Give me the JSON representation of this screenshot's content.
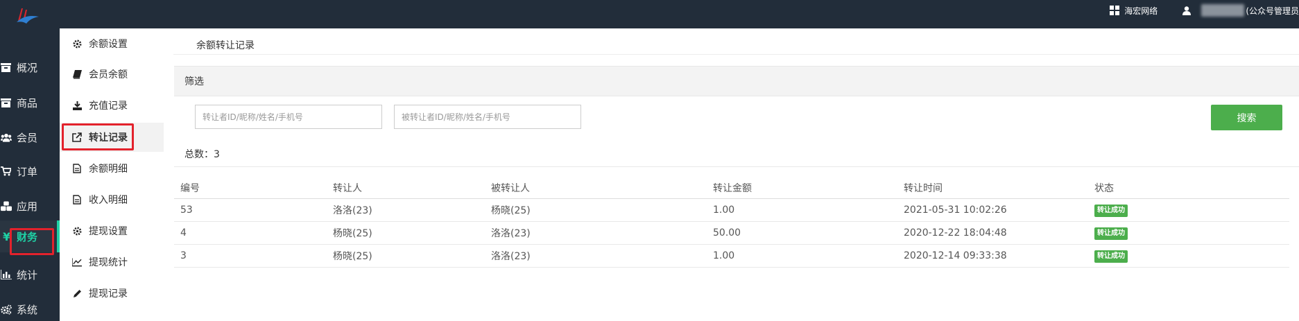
{
  "topbar": {
    "brand_icon": "logo-icon",
    "site_link": "海宏网络",
    "user_label": "(公众号管理员"
  },
  "nav_primary": [
    {
      "label": "概况",
      "icon": "box-icon"
    },
    {
      "label": "商品",
      "icon": "box-icon"
    },
    {
      "label": "会员",
      "icon": "users-icon"
    },
    {
      "label": "订单",
      "icon": "cart-icon"
    },
    {
      "label": "应用",
      "icon": "cubes-icon"
    },
    {
      "label": "财务",
      "icon": "yen-icon",
      "active": true
    },
    {
      "label": "统计",
      "icon": "bar-chart-icon"
    },
    {
      "label": "系统",
      "icon": "gears-icon"
    }
  ],
  "nav_secondary": [
    {
      "label": "余额设置",
      "icon": "gear-icon"
    },
    {
      "label": "会员余额",
      "icon": "book-icon"
    },
    {
      "label": "充值记录",
      "icon": "download-icon"
    },
    {
      "label": "转让记录",
      "icon": "external-link-icon",
      "active": true
    },
    {
      "label": "余额明细",
      "icon": "file-icon"
    },
    {
      "label": "收入明细",
      "icon": "file-icon"
    },
    {
      "label": "提现设置",
      "icon": "gear-icon"
    },
    {
      "label": "提现统计",
      "icon": "line-chart-icon"
    },
    {
      "label": "提现记录",
      "icon": "pencil-icon"
    }
  ],
  "main": {
    "breadcrumb": "余额转让记录",
    "filter_title": "筛选",
    "filters": {
      "from_placeholder": "转让者ID/昵称/姓名/手机号",
      "to_placeholder": "被转让者ID/昵称/姓名/手机号",
      "search_label": "搜索"
    },
    "total_label": "总数：",
    "total_value": "3",
    "table": {
      "columns": [
        "编号",
        "转让人",
        "被转让人",
        "转让金额",
        "转让时间",
        "状态"
      ],
      "rows": [
        {
          "id": "53",
          "from": "洛洛(23)",
          "to": "杨晓(25)",
          "amount": "1.00",
          "time": "2021-05-31 10:02:26",
          "status": "转让成功"
        },
        {
          "id": "4",
          "from": "杨晓(25)",
          "to": "洛洛(23)",
          "amount": "50.00",
          "time": "2020-12-22 18:04:48",
          "status": "转让成功"
        },
        {
          "id": "3",
          "from": "杨晓(25)",
          "to": "洛洛(23)",
          "amount": "1.00",
          "time": "2020-12-14 09:33:38",
          "status": "转让成功"
        }
      ]
    }
  },
  "colors": {
    "topbar_bg": "#222d3a",
    "accent": "#1fd1a5",
    "success": "#4cae4c",
    "highlight_box": "#e3222c"
  }
}
